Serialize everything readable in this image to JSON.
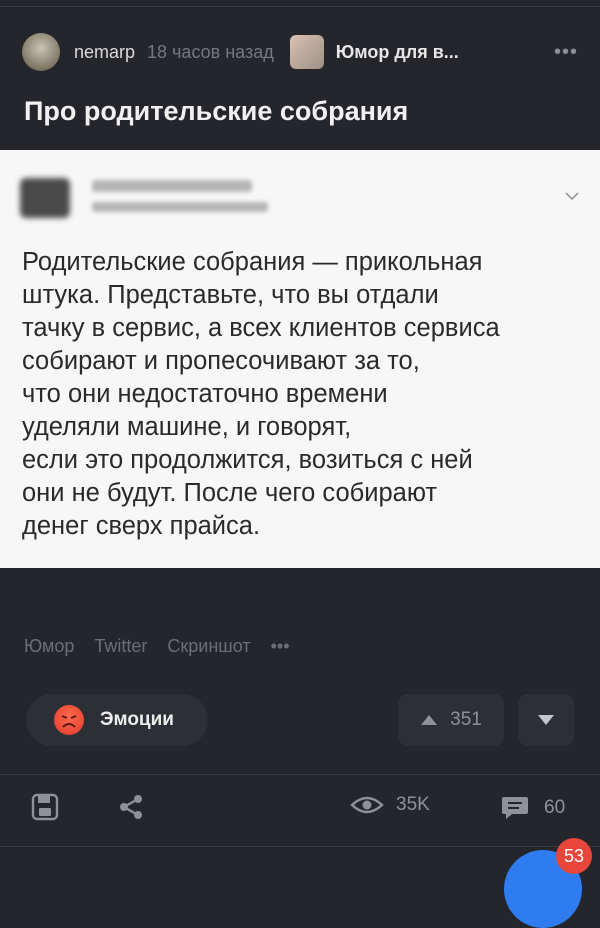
{
  "post": {
    "author": "nemarp",
    "time": "18 часов назад",
    "community": "Юмор для в...",
    "title": "Про родительские собрания",
    "more_icon": "more-icon"
  },
  "tweet": {
    "text": "Родительские собрания — прикольная\nштука. Представьте, что вы отдали\nтачку в сервис, а всех клиентов сервиса\nсобирают и пропесочивают за то,\nчто они недостаточно времени\nуделяли машине, и говорят,\nесли это продолжится, возиться с ней\nони не будут. После чего собирают\nденег сверх прайса.",
    "chevron_icon": "chevron-down-icon"
  },
  "tags": [
    "Юмор",
    "Twitter",
    "Скриншот"
  ],
  "actions": {
    "emotions_label": "Эмоции",
    "rating": "351"
  },
  "stats": {
    "views": "35K",
    "comments": "60"
  },
  "notification_badge": "53",
  "colors": {
    "background": "#24262b",
    "card": "#f7f7f7",
    "button": "#2c2f35",
    "accent": "#2e7cf0",
    "badge": "#e8463a"
  }
}
